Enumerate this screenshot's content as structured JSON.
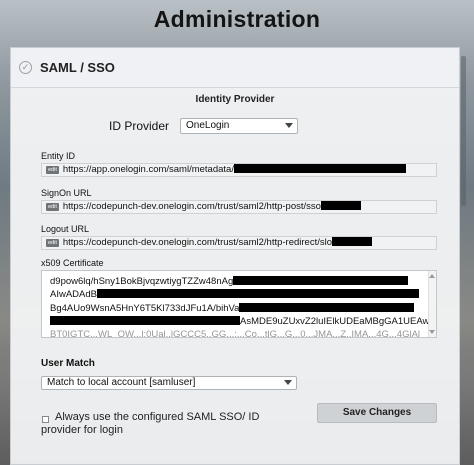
{
  "page": {
    "title": "Administration"
  },
  "section": {
    "title": "SAML / SSO",
    "subtitle": "Identity Provider"
  },
  "idp": {
    "label": "ID Provider",
    "selected": "OneLogin"
  },
  "fields": [
    {
      "label": "Entity ID",
      "edit": "edit",
      "value": "https://app.onelogin.com/saml/metadata/"
    },
    {
      "label": "SignOn URL",
      "edit": "edit",
      "value": "https://codepunch-dev.onelogin.com/trust/saml2/http-post/sso"
    },
    {
      "label": "Logout URL",
      "edit": "edit",
      "value": "https://codepunch-dev.onelogin.com/trust/saml2/http-redirect/slo"
    }
  ],
  "certificate": {
    "label": "x509 Certificate",
    "lines": [
      "d9pow6lq/hSny1BokBjvqzwtiygTZZw48nAg",
      "AIwADAdB",
      "Bg4AUo9WsnA5HnY6T5Kl733dJFu1A/bihVa",
      "AsMDE9uZUxvZ2luIElkUDEaMBgGA1UEAw",
      "BT0IGTC...WL_OW...l:0Ual..lGCCC5..GG...:...Co...tlG...G...0...JMA...Z..IMA...4G...4GlAl"
    ]
  },
  "user_match": {
    "label": "User Match",
    "selected": "Match to local account [samluser]"
  },
  "options": {
    "always_label": "Always use the configured SAML SSO/ ID provider for login",
    "always_checked": false
  },
  "actions": {
    "save_label": "Save Changes"
  }
}
